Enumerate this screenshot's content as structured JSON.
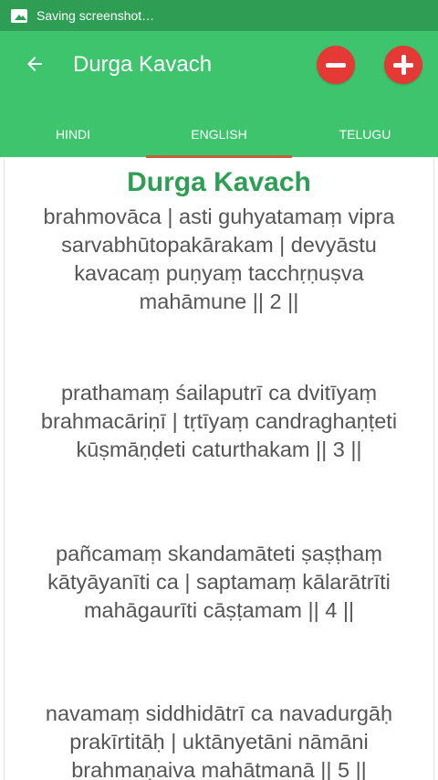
{
  "status_bar": {
    "notification_icon": "image-icon",
    "text": "Saving screenshot…"
  },
  "app_bar": {
    "title": "Durga Kavach",
    "back_icon": "arrow-left-icon",
    "decrease_icon": "minus-icon",
    "increase_icon": "plus-icon",
    "accent_color": "#3ec46d",
    "button_color": "#e53935"
  },
  "tabs": [
    {
      "label": "HINDI"
    },
    {
      "label": "ENGLISH",
      "active": true
    },
    {
      "label": "TELUGU"
    }
  ],
  "content": {
    "title": "Durga Kavach",
    "title_color": "#2f9e55",
    "verses": [
      [
        "brahmovāca | asti guhyatamaṃ vipra",
        "sarvabhūtopakārakam | devyāstu",
        "kavacaṃ puṇyaṃ tacchṛṇuṣva",
        "mahāmune || 2 ||"
      ],
      [
        "prathamaṃ śailaputrī ca dvitīyaṃ",
        "brahmacāriṇī | tṛtīyaṃ candraghaṇṭeti",
        "kūṣmāṇḍeti caturthakam || 3 ||"
      ],
      [
        "pañcamaṃ skandamāteti ṣaṣṭhaṃ",
        "kātyāyanīti ca | saptamaṃ kālarātrīti",
        "mahāgaurīti cāṣṭamam || 4 ||"
      ],
      [
        "navamaṃ siddhidātrī ca navadurgāḥ",
        "prakīrtitāḥ | uktānyetāni nāmāni",
        "brahmaṇaiva mahātmanā || 5 ||"
      ]
    ]
  }
}
